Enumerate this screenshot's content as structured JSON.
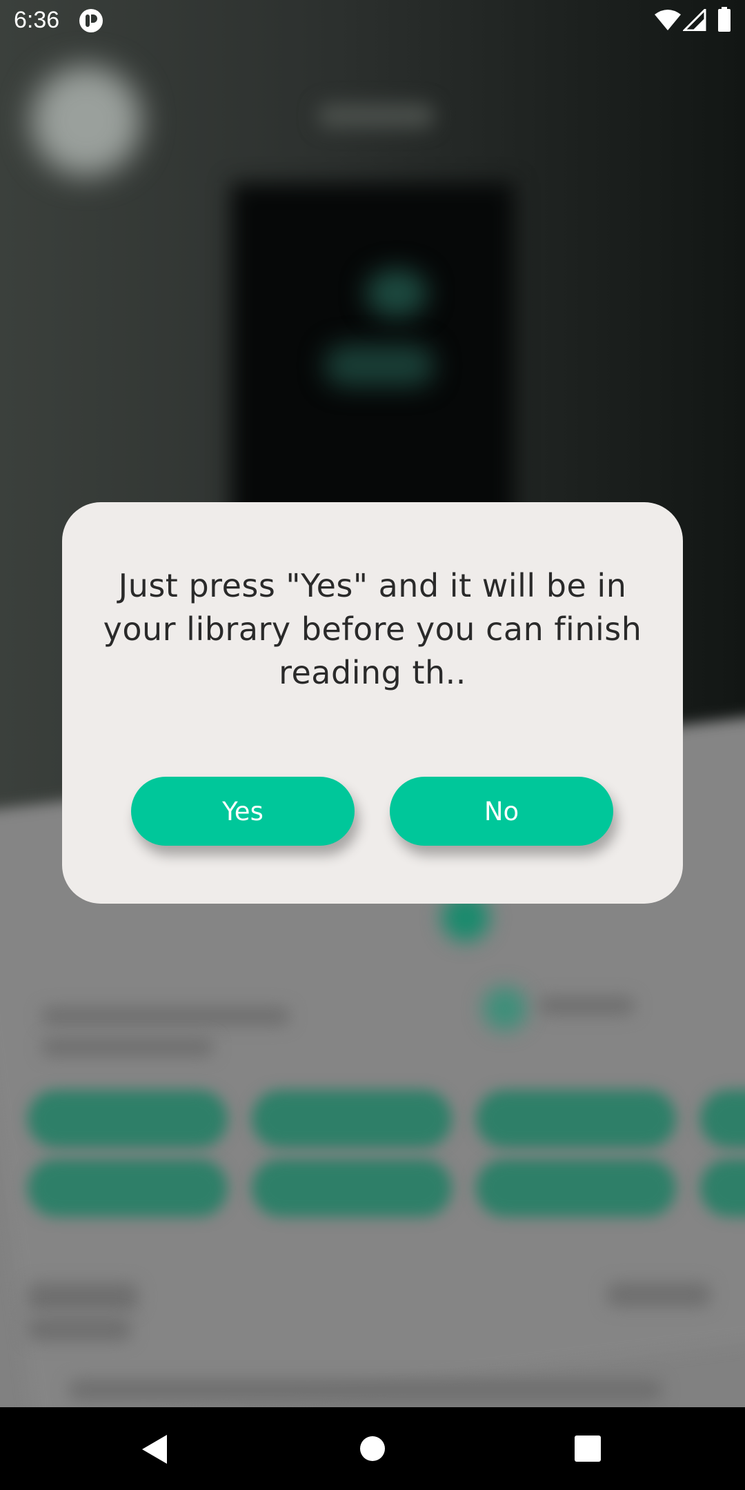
{
  "status_bar": {
    "time": "6:36",
    "icons": [
      "app-notification-icon",
      "wifi-icon",
      "cell-signal-icon",
      "battery-icon"
    ]
  },
  "dialog": {
    "message": "Just press \"Yes\" and it will be in your library before you can finish reading th..",
    "yes_label": "Yes",
    "no_label": "No"
  },
  "navigation_bar": {
    "icons": [
      "back-icon",
      "home-icon",
      "recents-icon"
    ]
  },
  "colors": {
    "accent": "#00c79a",
    "dialog_background": "#efecea",
    "dialog_text": "#2a2a2a",
    "nav_bar": "#000000"
  }
}
